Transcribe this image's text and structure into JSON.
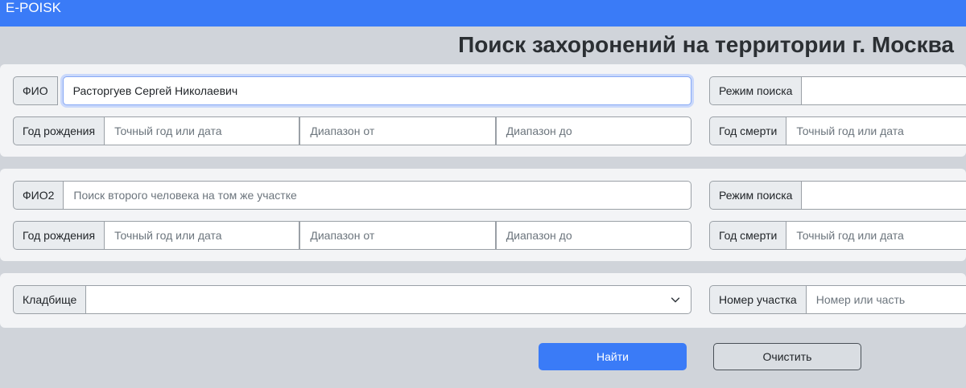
{
  "app": {
    "brand": "E-POISK"
  },
  "page": {
    "title": "Поиск захоронений на территории г. Москва"
  },
  "search1": {
    "fio_label": "ФИО",
    "fio_value": "Расторгуев Сергей Николаевич",
    "mode_label": "Режим поиска",
    "mode_value": "",
    "birth_label": "Год рождения",
    "birth_exact_placeholder": "Точный год или дата",
    "birth_from_placeholder": "Диапазон от",
    "birth_to_placeholder": "Диапазон до",
    "death_label": "Год смерти",
    "death_exact_placeholder": "Точный год или дата"
  },
  "search2": {
    "fio_label": "ФИО2",
    "fio_placeholder": "Поиск второго человека на том же участке",
    "mode_label": "Режим поиска",
    "mode_value": "",
    "birth_label": "Год рождения",
    "birth_exact_placeholder": "Точный год или дата",
    "birth_from_placeholder": "Диапазон от",
    "birth_to_placeholder": "Диапазон до",
    "death_label": "Год смерти",
    "death_exact_placeholder": "Точный год или дата"
  },
  "location": {
    "cemetery_label": "Кладбище",
    "cemetery_value": "",
    "plot_label": "Номер участка",
    "plot_placeholder": "Номер или часть"
  },
  "actions": {
    "find_label": "Найти",
    "clear_label": "Очистить"
  },
  "colors": {
    "accent": "#3a7bf7",
    "background": "#d0d4da",
    "panel": "#f3f4f6"
  }
}
